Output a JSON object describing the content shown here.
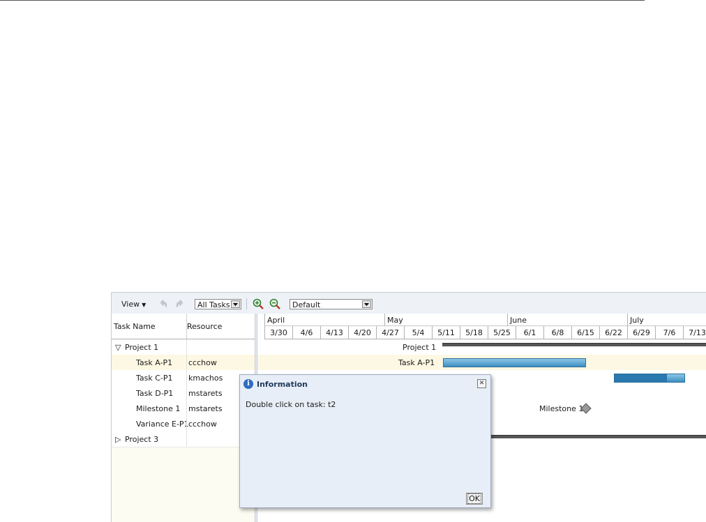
{
  "toolbar": {
    "view_label": "View",
    "filter_value": "All Tasks",
    "zoom_in_icon": "zoom-in-icon",
    "zoom_out_icon": "zoom-out-icon",
    "undo_icon": "undo-icon",
    "redo_icon": "redo-icon",
    "scale_value": "Default"
  },
  "tree": {
    "headers": {
      "name": "Task Name",
      "resource": "Resource"
    },
    "rows": [
      {
        "name": "Project 1",
        "resource": "",
        "expander": "▽"
      },
      {
        "name": "Task A-P1",
        "resource": "ccchow",
        "selected": true
      },
      {
        "name": "Task C-P1",
        "resource": "kmachos"
      },
      {
        "name": "Task D-P1",
        "resource": "mstarets"
      },
      {
        "name": "Milestone 1",
        "resource": "mstarets"
      },
      {
        "name": "Variance E-P1",
        "resource": "ccchow"
      },
      {
        "name": "Project 3",
        "resource": "",
        "expander": "▷"
      }
    ]
  },
  "timeline": {
    "months": [
      "April",
      "May",
      "June",
      "July"
    ],
    "weeks": [
      "3/30",
      "4/6",
      "4/13",
      "4/20",
      "4/27",
      "5/4",
      "5/11",
      "5/18",
      "5/25",
      "6/1",
      "6/8",
      "6/15",
      "6/22",
      "6/29",
      "7/6",
      "7/13"
    ]
  },
  "chart": {
    "labels": {
      "project1": "Project 1",
      "taskA": "Task A-P1",
      "milestone1": "Milestone 1"
    },
    "taskC_progress": 0.75,
    "colors": {
      "bar": "#4ea0cf",
      "progress": "#2a78ad",
      "summary": "#555555",
      "selected_row": "#fdf8e3"
    }
  },
  "dialog": {
    "title": "Information",
    "message": "Double click on task: t2",
    "ok_label": "OK",
    "icon": "info-icon"
  }
}
